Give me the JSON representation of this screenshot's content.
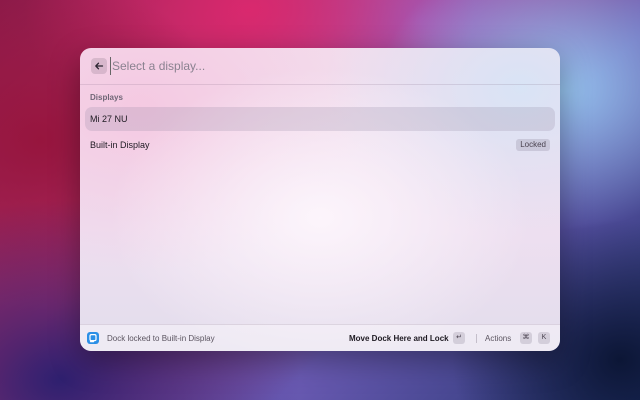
{
  "search": {
    "placeholder": "Select a display...",
    "value": ""
  },
  "section": {
    "title": "Displays"
  },
  "displays": [
    {
      "label": "Mi 27 NU",
      "tag": "",
      "selected": true
    },
    {
      "label": "Built-in Display",
      "tag": "Locked",
      "selected": false
    }
  ],
  "footer": {
    "toast": "Dock locked to Built-in Display",
    "primary_action": "Move Dock Here and Lock",
    "primary_key": "↵",
    "actions_label": "Actions",
    "actions_keys": [
      "⌘",
      "K"
    ]
  },
  "colors": {
    "toast_icon": "#2b8fe6",
    "selected_row": "#d9d0dc"
  },
  "icons": {
    "back": "arrow-left-icon",
    "toast": "extension-icon"
  }
}
